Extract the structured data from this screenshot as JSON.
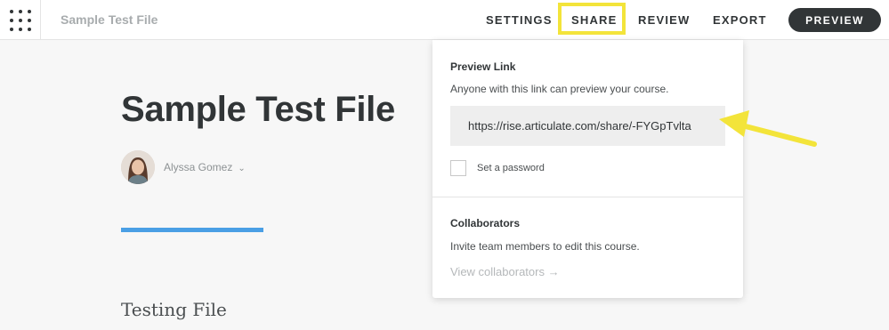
{
  "header": {
    "file_title": "Sample Test File",
    "nav": {
      "settings": "SETTINGS",
      "share": "SHARE",
      "review": "REVIEW",
      "export": "EXPORT"
    },
    "preview_button": "PREVIEW"
  },
  "course": {
    "title": "Sample Test File",
    "author": "Alyssa Gomez",
    "author_caret": "⌄",
    "section_title": "Testing File"
  },
  "share_menu": {
    "preview_link": {
      "heading": "Preview Link",
      "description": "Anyone with this link can preview your course.",
      "url": "https://rise.articulate.com/share/-FYGpTvlta",
      "password_label": "Set a password"
    },
    "collaborators": {
      "heading": "Collaborators",
      "description": "Invite team members to edit this course.",
      "link_label": "View collaborators →"
    }
  },
  "colors": {
    "highlight": "#f3e43a",
    "accent_bar": "#4a9fe5",
    "dark": "#313537"
  }
}
